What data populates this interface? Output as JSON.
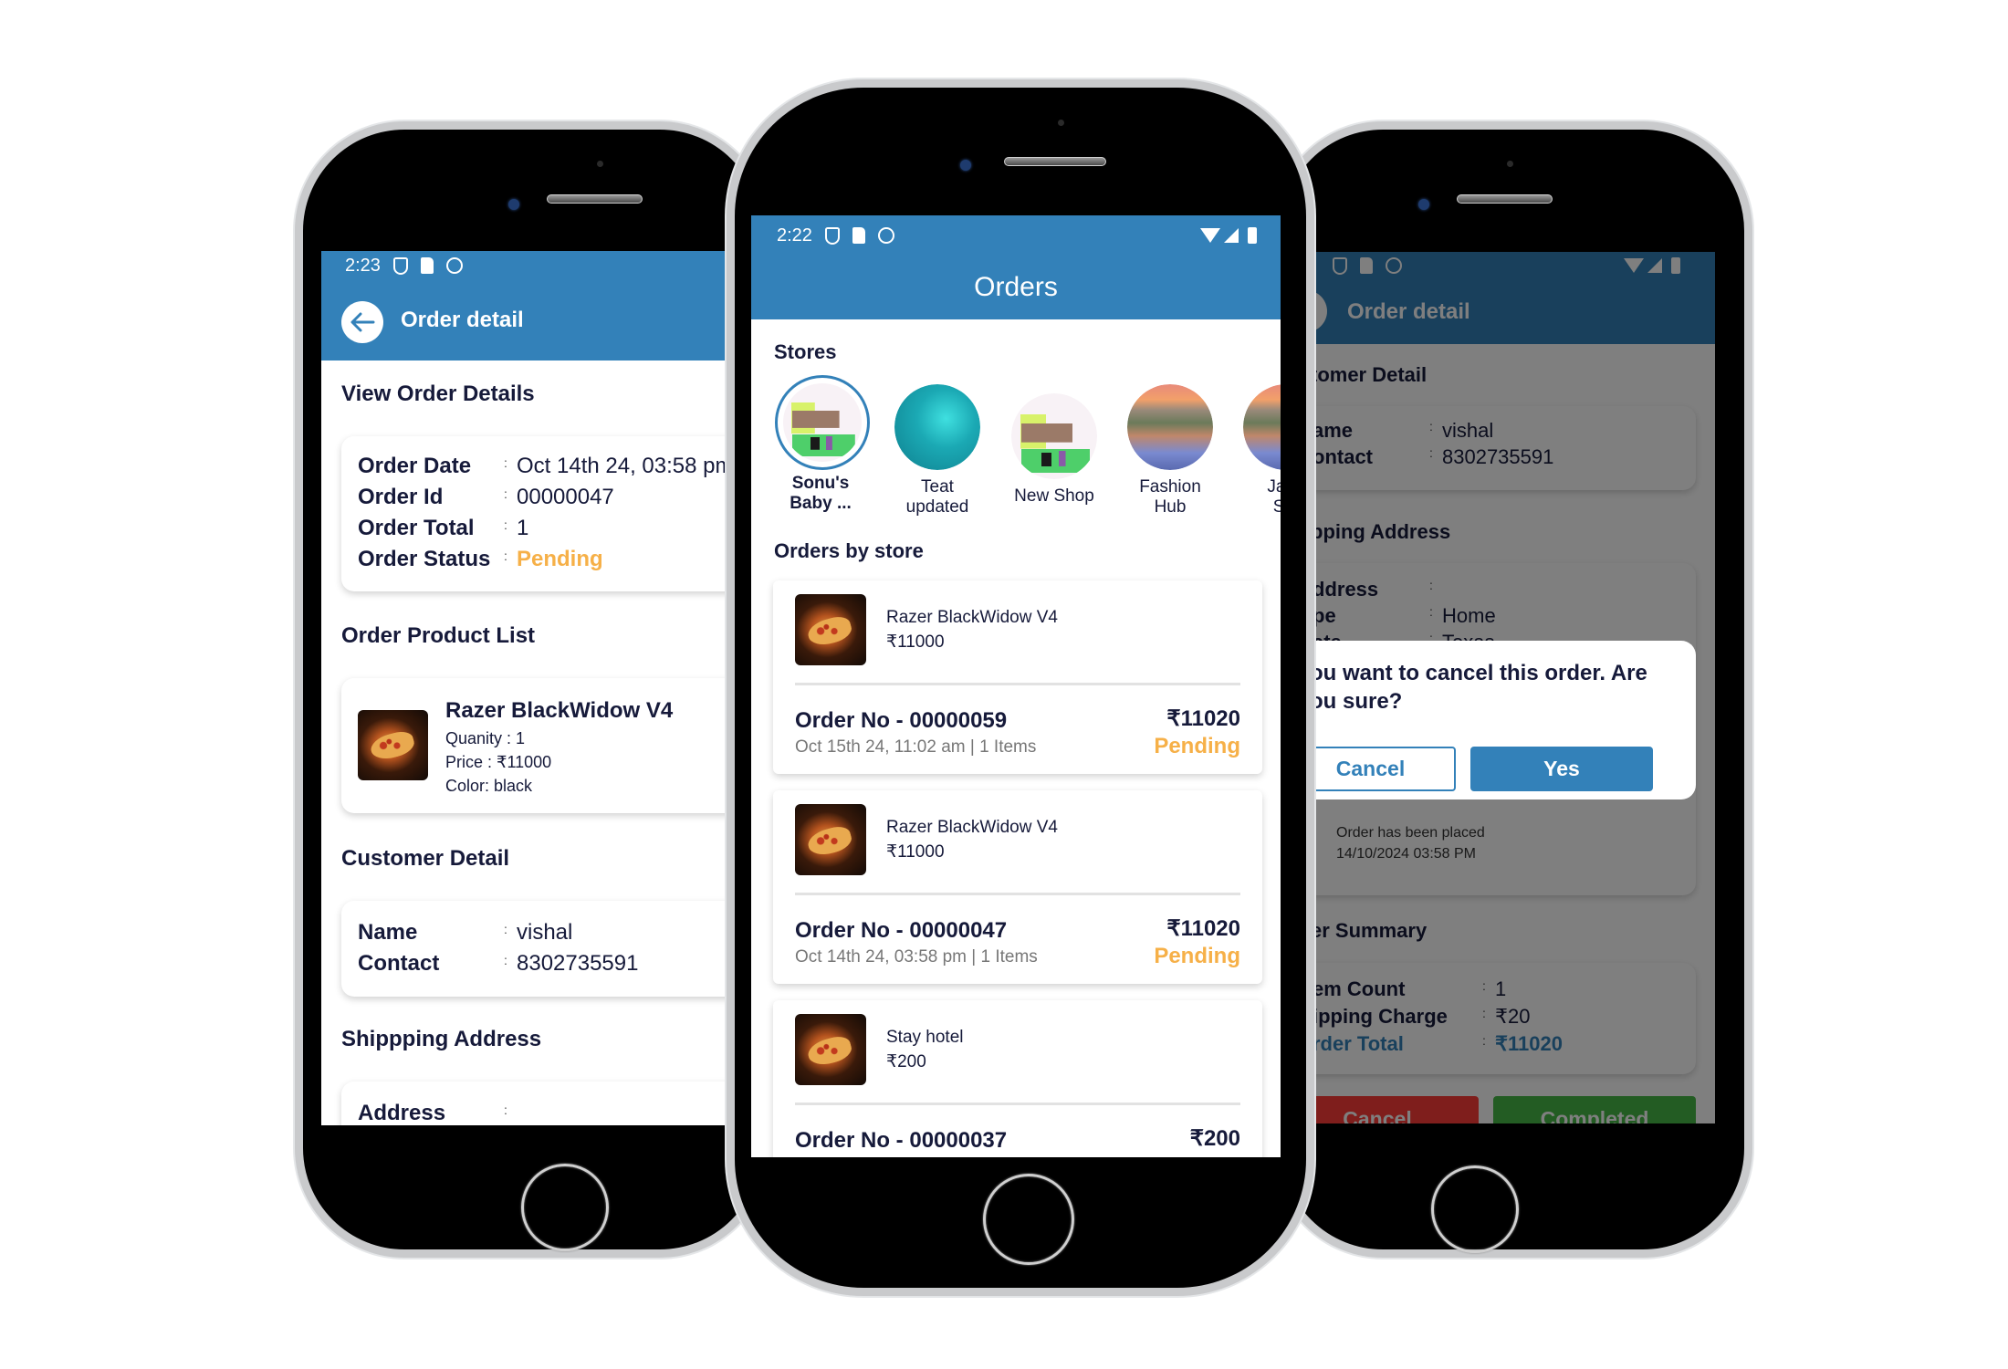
{
  "left_screen": {
    "status_time": "2:23",
    "appbar_title": "Order detail",
    "back_icon": "arrow-left-icon",
    "sections": {
      "view_order_details": "View Order Details",
      "order_product_list": "Order Product List",
      "customer_detail": "Customer Detail",
      "shipping_address": "Shippping Address"
    },
    "order_details": {
      "rows": [
        {
          "label": "Order Date",
          "value": "Oct 14th 24, 03:58 pm"
        },
        {
          "label": "Order Id",
          "value": "00000047"
        },
        {
          "label": "Order Total",
          "value": "1"
        },
        {
          "label": "Order Status",
          "value": "Pending"
        }
      ]
    },
    "product": {
      "name": "Razer BlackWidow V4",
      "quantity": "Quanity : 1",
      "price": "Price : ₹11000",
      "color": "Color: black"
    },
    "customer": {
      "rows": [
        {
          "label": "Name",
          "value": "vishal"
        },
        {
          "label": "Contact",
          "value": "8302735591"
        }
      ]
    },
    "address": {
      "rows": [
        {
          "label": "Address",
          "value": ""
        }
      ]
    },
    "separator": ":"
  },
  "center_screen": {
    "status_time": "2:22",
    "appbar_title": "Orders",
    "stores_title": "Stores",
    "stores": [
      {
        "name": "Sonu's Baby ...",
        "line1": "Sonu's",
        "line2": "Baby ...",
        "selected": true,
        "image": "pixel-shop"
      },
      {
        "name": "Teat updated",
        "line1": "Teat",
        "line2": "updated",
        "selected": false,
        "image": "teal-hexagons"
      },
      {
        "name": "New Shop",
        "line1": "New Shop",
        "line2": "",
        "selected": false,
        "image": "pixel-shop"
      },
      {
        "name": "Fashion Hub",
        "line1": "Fashion",
        "line2": "Hub",
        "selected": false,
        "image": "lake-landscape"
      },
      {
        "name": "Jagd Sto",
        "line1": "Jagd",
        "line2": "Sto",
        "selected": false,
        "image": "lake-landscape"
      }
    ],
    "orders_title": "Orders by store",
    "orders": [
      {
        "product": "Razer BlackWidow V4",
        "product_price": "₹11000",
        "order_no": "Order No - 00000059",
        "date": "Oct 15th 24, 11:02 am | 1 Items",
        "total": "₹11020",
        "status": "Pending"
      },
      {
        "product": "Razer BlackWidow V4",
        "product_price": "₹11000",
        "order_no": "Order No - 00000047",
        "date": "Oct 14th 24, 03:58 pm | 1 Items",
        "total": "₹11020",
        "status": "Pending"
      },
      {
        "product": "Stay hotel",
        "product_price": "₹200",
        "order_no": "Order No - 00000037",
        "date": "",
        "total": "₹200",
        "status": ""
      }
    ]
  },
  "right_screen": {
    "appbar_title": "Order detail",
    "sections": {
      "customer_detail": "tomer Detail",
      "shipping_address": "pping Address",
      "order_summary": "er Summary"
    },
    "customer": {
      "rows": [
        {
          "label": "ame",
          "value": "vishal"
        },
        {
          "label": "ontact",
          "value": "8302735591"
        }
      ]
    },
    "address": {
      "rows": [
        {
          "label": "ddress",
          "value": ""
        },
        {
          "label": "pe",
          "value": "Home"
        },
        {
          "label": "ate",
          "value": "Texas"
        }
      ]
    },
    "timeline": {
      "text": "Order has been placed",
      "time": "14/10/2024 03:58 PM"
    },
    "summary": {
      "rows": [
        {
          "label": "em Count",
          "value": "1"
        },
        {
          "label": "ipping Charge",
          "value": "₹20"
        },
        {
          "label": "rder Total",
          "value": "₹11020"
        }
      ]
    },
    "bottom_buttons": {
      "cancel": "Cancel",
      "completed": "Completed"
    },
    "dialog": {
      "message": "ou want to cancel this order. Are ou sure?",
      "line1": "ou want to cancel this order. Are",
      "line2": "ou sure?",
      "cancel": "Cancel",
      "yes": "Yes"
    }
  },
  "colors": {
    "primary": "#3381b9",
    "pending": "#f6b048",
    "text_dark": "#161a3a",
    "cancel_red": "#c7302e",
    "complete_green": "#2e8a2e"
  }
}
